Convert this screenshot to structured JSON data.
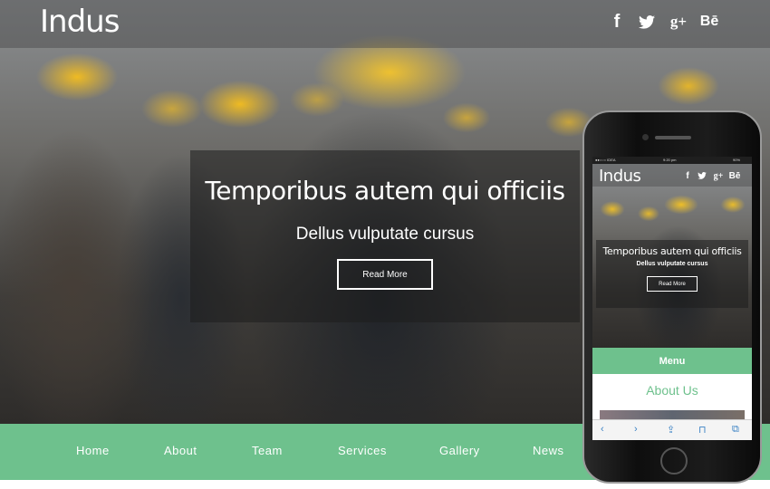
{
  "site": {
    "logo": "Indus",
    "social": [
      {
        "icon": "facebook-icon",
        "glyph": "f"
      },
      {
        "icon": "twitter-icon",
        "glyph": ""
      },
      {
        "icon": "google-plus-icon",
        "glyph": "g+"
      },
      {
        "icon": "behance-icon",
        "glyph": "Bē"
      }
    ]
  },
  "banner": {
    "title": "Temporibus autem qui officiis",
    "subtitle": "Dellus vulputate cursus",
    "button": "Read More"
  },
  "nav": {
    "items": [
      "Home",
      "About",
      "Team",
      "Services",
      "Gallery",
      "News"
    ]
  },
  "phone": {
    "status_carrier": "●●○○○ IDEA",
    "status_time": "9:20 pm",
    "status_battery": "90%",
    "logo": "Indus",
    "banner_title": "Temporibus autem qui officiis",
    "banner_subtitle": "Dellus vulputate cursus",
    "banner_button": "Read More",
    "menu_label": "Menu",
    "section_title": "About Us"
  },
  "colors": {
    "accent_green": "#6ec18d",
    "white": "#ffffff"
  }
}
